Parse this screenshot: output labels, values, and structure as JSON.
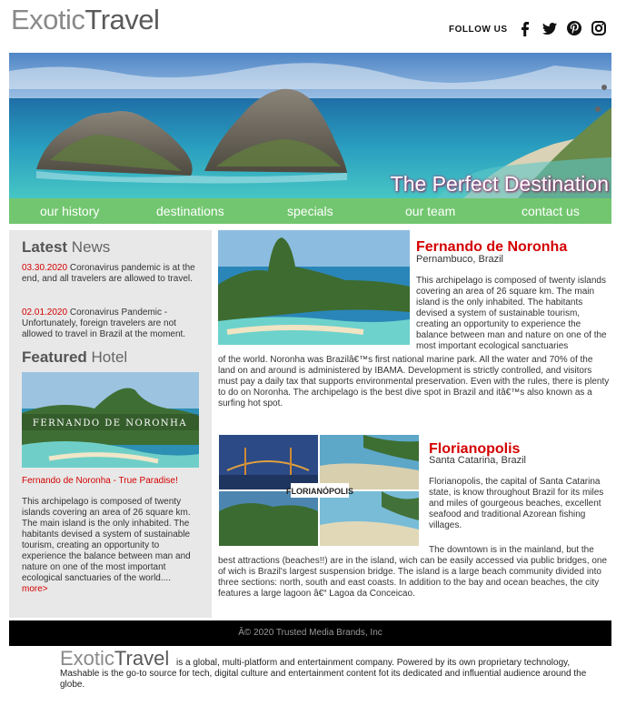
{
  "header": {
    "logo_part1": "Exotic",
    "logo_part2": "Travel",
    "follow_label": "FOLLOW US",
    "social_icons": [
      "facebook-icon",
      "twitter-icon",
      "pinterest-icon",
      "instagram-icon"
    ]
  },
  "hero": {
    "title": "The Perfect Destination"
  },
  "nav": {
    "items": [
      "our history",
      "destinations",
      "specials",
      "our team",
      "contact us"
    ]
  },
  "sidebar": {
    "news_heading_bold": "Latest",
    "news_heading_rest": " News",
    "news": [
      {
        "date": "03.30.2020",
        "text": " Coronavirus pandemic is at the end, and all travelers are allowed to travel."
      },
      {
        "date": "02.01.2020",
        "text": " Coronavirus Pandemic - Unfortunately, foreign travelers are not allowed to travel in Brazil at the moment."
      }
    ],
    "hotel_heading_bold": "Featured",
    "hotel_heading_rest": " Hotel",
    "hotel_image_text": "FERNANDO DE NORONHA",
    "hotel_caption": "Fernando de Noronha - True Paradise!",
    "hotel_text": "This archipelago is composed of twenty islands covering an area of 26 square km. The main island is the only inhabited. The habitants devised a system of sustainable tourism, creating an opportunity to experience the balance between man and nature on one of the most important ecological sanctuaries of the world....",
    "hotel_more": "more>"
  },
  "articles": [
    {
      "title": "Fernando de Noronha",
      "subtitle": "Pernambuco, Brazil",
      "body_side": "This archipelago is composed of twenty islands covering an area of 26 square km. The main island is the only inhabited. The habitants devised a system of sustainable tourism, creating an opportunity to experience the balance between man and nature on one of the most important ecological sanctuaries",
      "body_full": "of the world. Noronha was Brazilâ€™s first national marine park. All the water and 70% of the land on and around is administered by IBAMA. Development is strictly controlled, and visitors must pay a daily tax that supports environmental preservation. Even with the rules, there is plenty to do on Noronha. The archipelago is the best dive spot in Brazil and itâ€™s also known as a surfing hot spot."
    },
    {
      "title": "Florianopolis",
      "subtitle": "Santa Catarina, Brazil",
      "image_label": "FLORIANÓPOLIS",
      "body_side": "Florianopolis, the capital of Santa Catarina state, is know throughout Brazil for its miles and miles of gourgeous beaches, excellent seafood and traditional Azorean fishing villages.",
      "body_side2": "The downtown is in the mainland, but the",
      "body_full": "best attractions (beaches!!) are in the island, wich can be easily accessed via public bridges, one of wich is Brazil's largest suspension bridge. The island is a large beach community divided into three sections: north, south and east coasts. In addition to the bay and ocean beaches, the city features a large lagoon â€“ Lagoa da Conceicao."
    }
  ],
  "footer": {
    "copyright": "Â© 2020 Trusted Media Brands, Inc",
    "logo_part1": "Exotic",
    "logo_part2": "Travel",
    "about": "is a global, multi-platform and entertainment company. Powered by its own proprietary technology, Mashable is the go-to source for tech, digital culture and entertainment content fot its dedicated and influential audience around the globe."
  }
}
